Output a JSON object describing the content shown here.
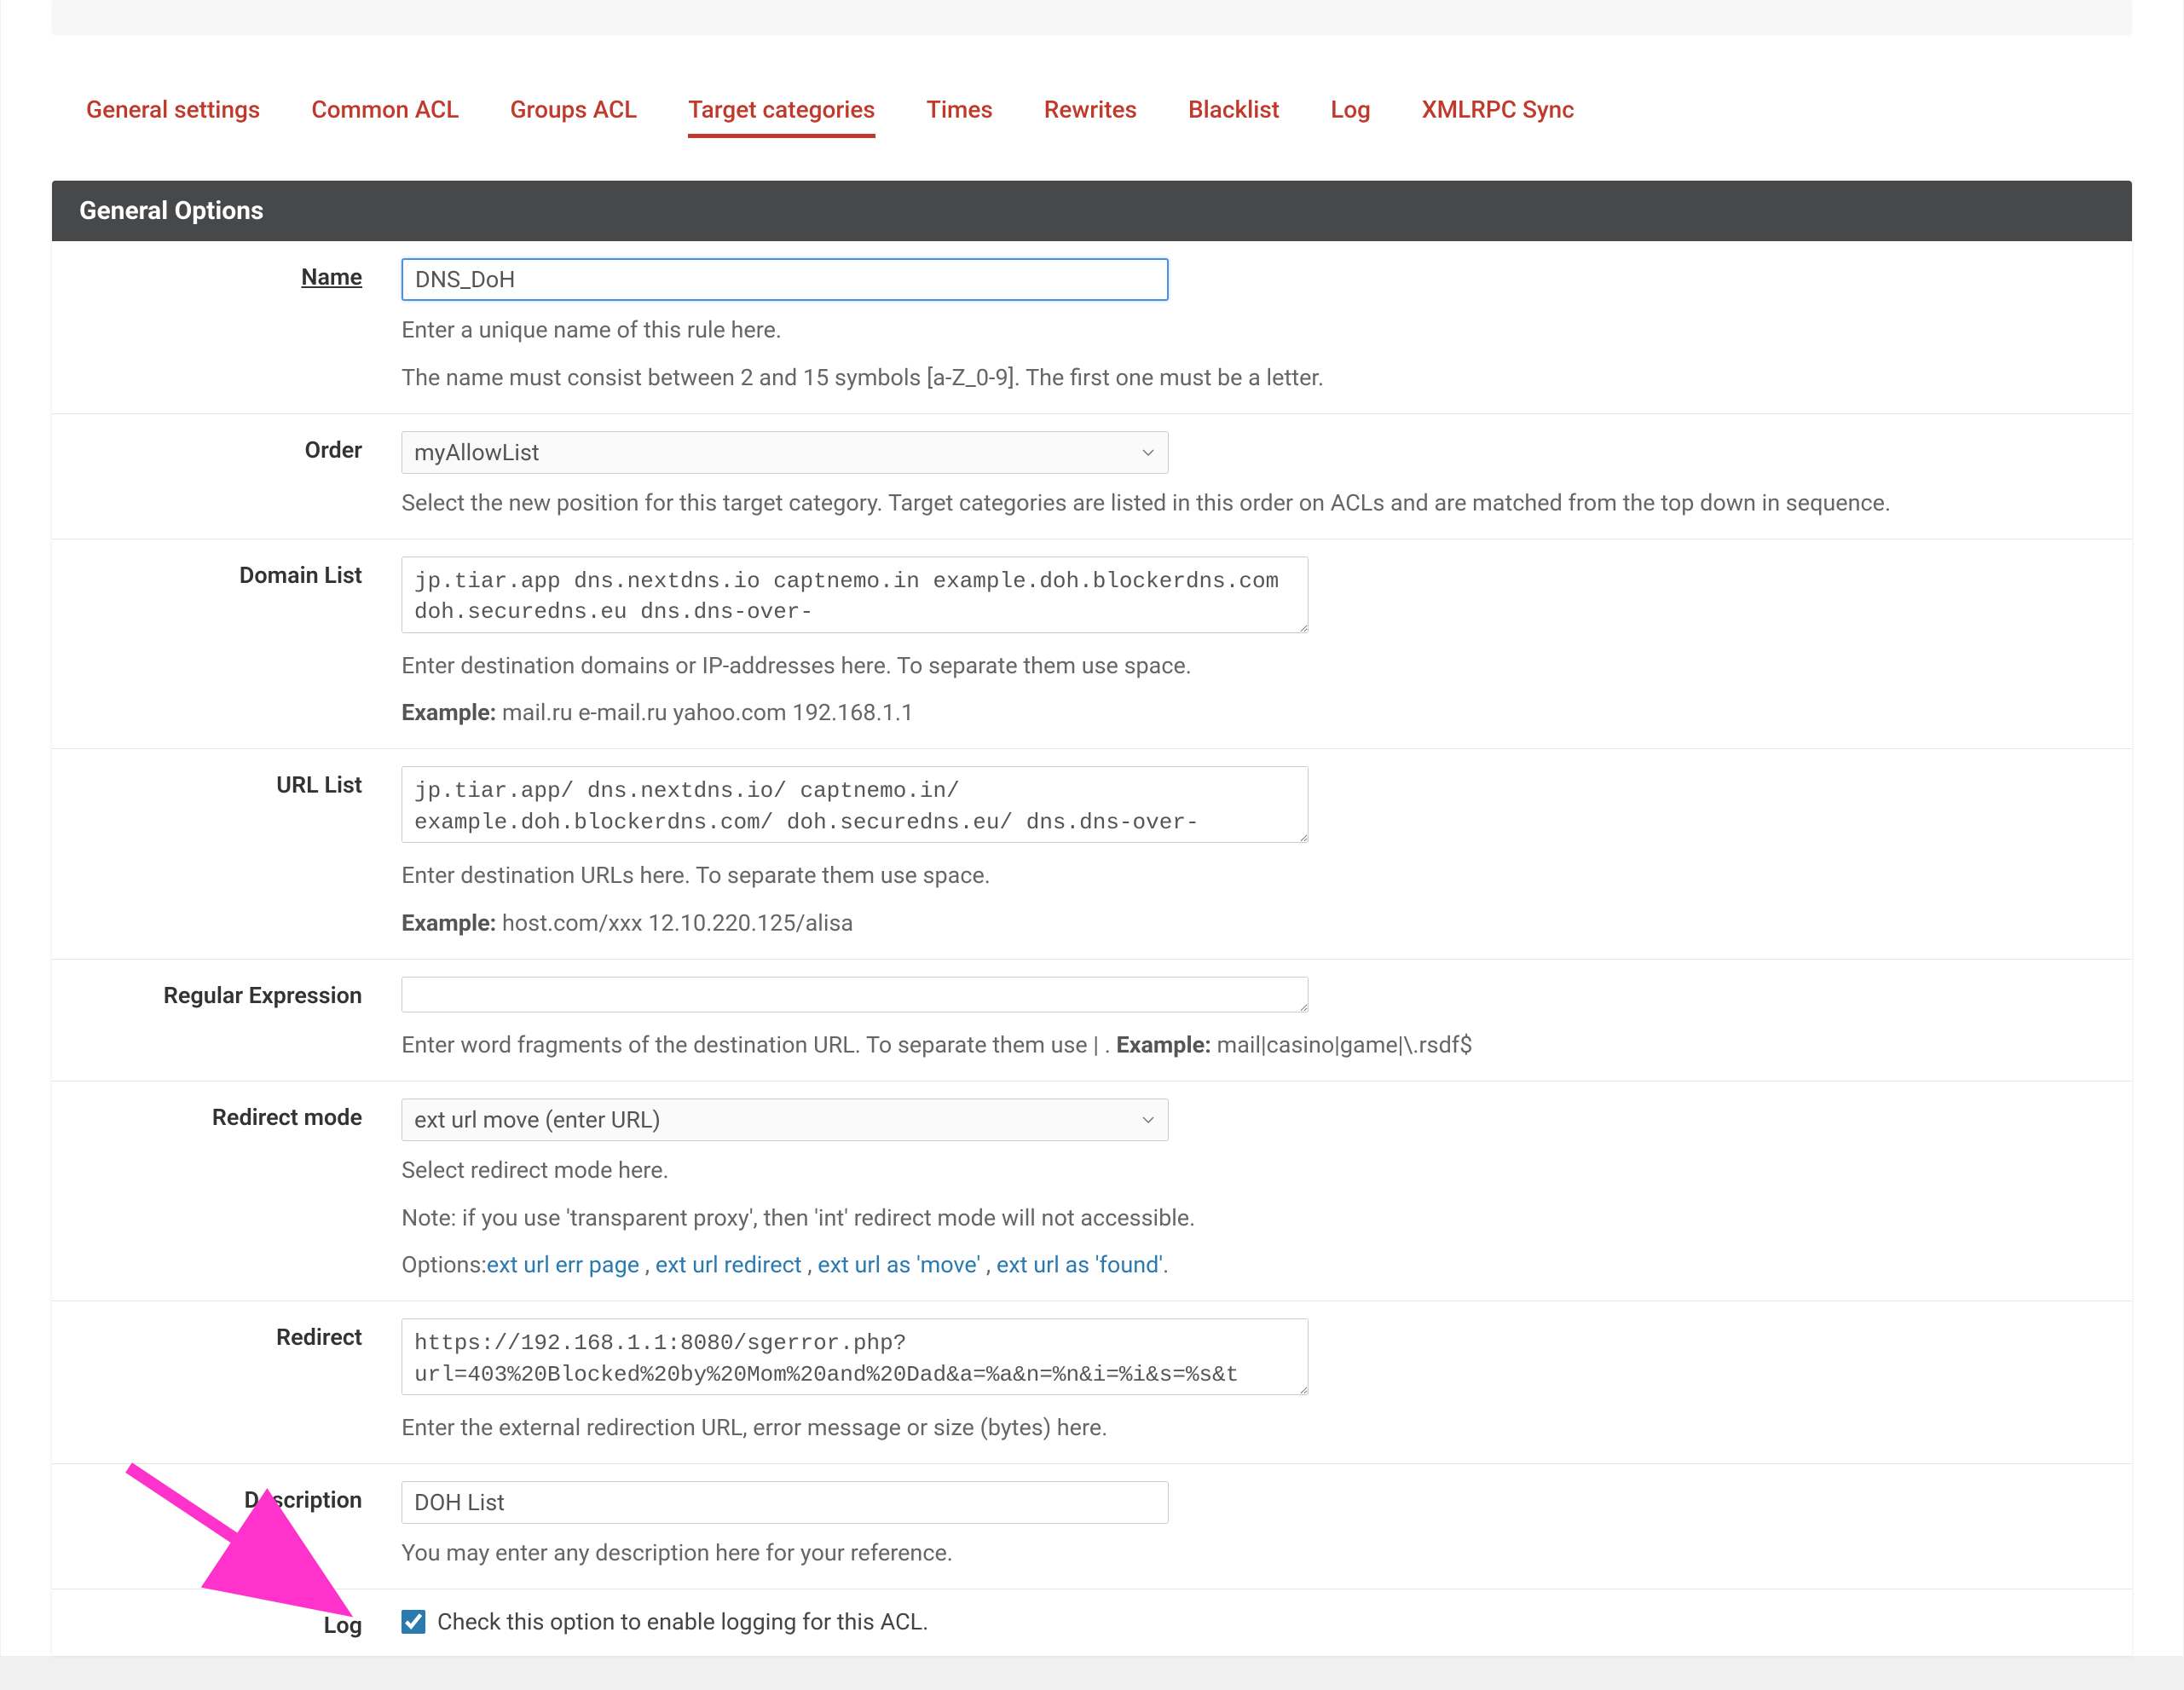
{
  "tabs": [
    {
      "label": "General settings"
    },
    {
      "label": "Common ACL"
    },
    {
      "label": "Groups ACL"
    },
    {
      "label": "Target categories",
      "active": true
    },
    {
      "label": "Times"
    },
    {
      "label": "Rewrites"
    },
    {
      "label": "Blacklist"
    },
    {
      "label": "Log"
    },
    {
      "label": "XMLRPC Sync"
    }
  ],
  "panel": {
    "title": "General Options"
  },
  "fields": {
    "name": {
      "label": "Name",
      "value": "DNS_DoH",
      "help1": "Enter a unique name of this rule here.",
      "help2": "The name must consist between 2 and 15 symbols [a-Z_0-9]. The first one must be a letter."
    },
    "order": {
      "label": "Order",
      "value": "myAllowList",
      "help": "Select the new position for this target category. Target categories are listed in this order on ACLs and are matched from the top down in sequence."
    },
    "domain_list": {
      "label": "Domain List",
      "value": "jp.tiar.app dns.nextdns.io captnemo.in example.doh.blockerdns.com doh.securedns.eu dns.dns-over-",
      "help": "Enter destination domains or IP-addresses here. To separate them use space.",
      "example_label": "Example:",
      "example_value": " mail.ru e-mail.ru yahoo.com 192.168.1.1"
    },
    "url_list": {
      "label": "URL List",
      "value": "jp.tiar.app/ dns.nextdns.io/ captnemo.in/ example.doh.blockerdns.com/ doh.securedns.eu/ dns.dns-over-",
      "help": "Enter destination URLs here. To separate them use space.",
      "example_label": "Example:",
      "example_value": " host.com/xxx 12.10.220.125/alisa"
    },
    "regex": {
      "label": "Regular Expression",
      "value": "",
      "help_prefix": "Enter word fragments of the destination URL. To separate them use | . ",
      "example_label": "Example:",
      "example_value": " mail|casino|game|\\.rsdf$"
    },
    "redirect_mode": {
      "label": "Redirect mode",
      "value": "ext url move (enter URL)",
      "help1": "Select redirect mode here.",
      "help2": "Note: if you use 'transparent proxy', then 'int' redirect mode will not accessible.",
      "options_prefix": "Options:",
      "opt1": "ext url err page",
      "opt2": "ext url redirect",
      "opt3": "ext url as 'move'",
      "opt4": "ext url as 'found'",
      "sep": " , ",
      "dot": "."
    },
    "redirect": {
      "label": "Redirect",
      "value": "https://192.168.1.1:8080/sgerror.php?url=403%20Blocked%20by%20Mom%20and%20Dad&a=%a&n=%n&i=%i&s=%s&t",
      "help": "Enter the external redirection URL, error message or size (bytes) here."
    },
    "description": {
      "label": "Description",
      "value": "DOH List",
      "help": "You may enter any description here for your reference."
    },
    "log": {
      "label": "Log",
      "checkbox_label": "Check this option to enable logging for this ACL."
    }
  }
}
